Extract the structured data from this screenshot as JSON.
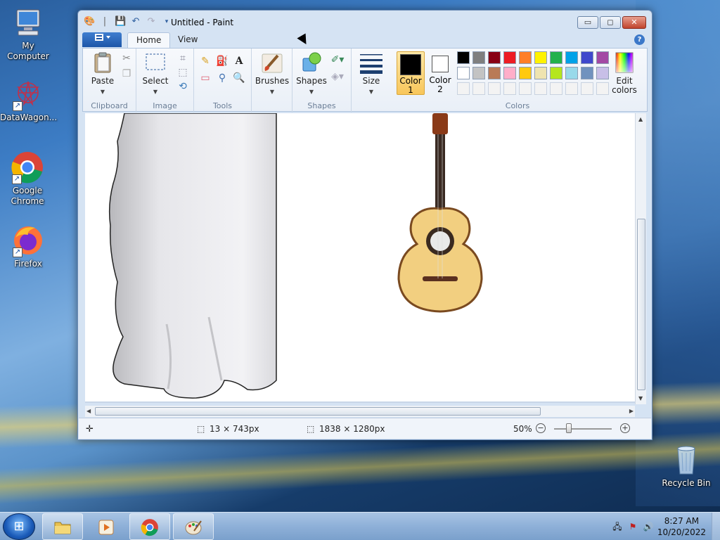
{
  "desktop": {
    "icons": [
      {
        "label": "My Computer"
      },
      {
        "label": "DataWagon..."
      },
      {
        "label": "Google Chrome"
      },
      {
        "label": "Firefox"
      },
      {
        "label": "Recycle Bin"
      }
    ]
  },
  "window": {
    "title": "Untitled - Paint",
    "controls": {
      "minimize": "▭",
      "maximize": "◻",
      "close": "✕"
    }
  },
  "ribbon": {
    "tabs": [
      "Home",
      "View"
    ],
    "active_tab": "Home",
    "help": "?",
    "groups": {
      "clipboard": {
        "label": "Clipboard",
        "paste": "Paste"
      },
      "image": {
        "label": "Image",
        "select": "Select"
      },
      "tools": {
        "label": "Tools"
      },
      "brushes": {
        "label": "Brushes"
      },
      "shapes": {
        "label": "Shapes",
        "button": "Shapes"
      },
      "size": {
        "label": "Size"
      },
      "colors": {
        "label": "Colors",
        "color1": "Color 1",
        "color2": "Color 2",
        "edit": "Edit colors",
        "color1_value": "#000000",
        "color2_value": "#ffffff",
        "palette_row1": [
          "#000000",
          "#7f7f7f",
          "#880015",
          "#ed1c24",
          "#ff7f27",
          "#fff200",
          "#22b14c",
          "#00a2e8",
          "#3f48cc",
          "#a349a4"
        ],
        "palette_row2": [
          "#ffffff",
          "#c3c3c3",
          "#b97a57",
          "#ffaec9",
          "#ffc90e",
          "#efe4b0",
          "#b5e61d",
          "#99d9ea",
          "#7092be",
          "#c8bfe7"
        ],
        "palette_row3": [
          "#f3f3f3",
          "#f3f3f3",
          "#f3f3f3",
          "#f3f3f3",
          "#f3f3f3",
          "#f3f3f3",
          "#f3f3f3",
          "#f3f3f3",
          "#f3f3f3",
          "#f3f3f3"
        ]
      }
    }
  },
  "statusbar": {
    "selection_size": "13 × 743px",
    "image_size": "1838 × 1280px",
    "zoom": "50%",
    "zoom_value": 0.5
  },
  "taskbar": {
    "time": "8:27 AM",
    "date": "10/20/2022"
  }
}
